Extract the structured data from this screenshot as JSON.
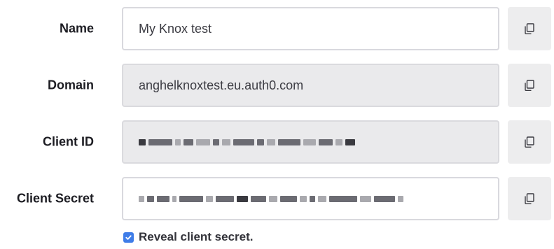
{
  "fields": {
    "name": {
      "label": "Name",
      "value": "My Knox test"
    },
    "domain": {
      "label": "Domain",
      "value": "anghelknoxtest.eu.auth0.com"
    },
    "client_id": {
      "label": "Client ID",
      "value": ""
    },
    "client_secret": {
      "label": "Client Secret",
      "value": ""
    }
  },
  "reveal": {
    "label": "Reveal client secret.",
    "checked": true
  },
  "icons": {
    "copy": "copy-icon",
    "check": "check-icon"
  },
  "colors": {
    "checkbox_accent": "#3f7de8",
    "readonly_bg": "#eaeaec",
    "button_bg": "#ededee"
  }
}
